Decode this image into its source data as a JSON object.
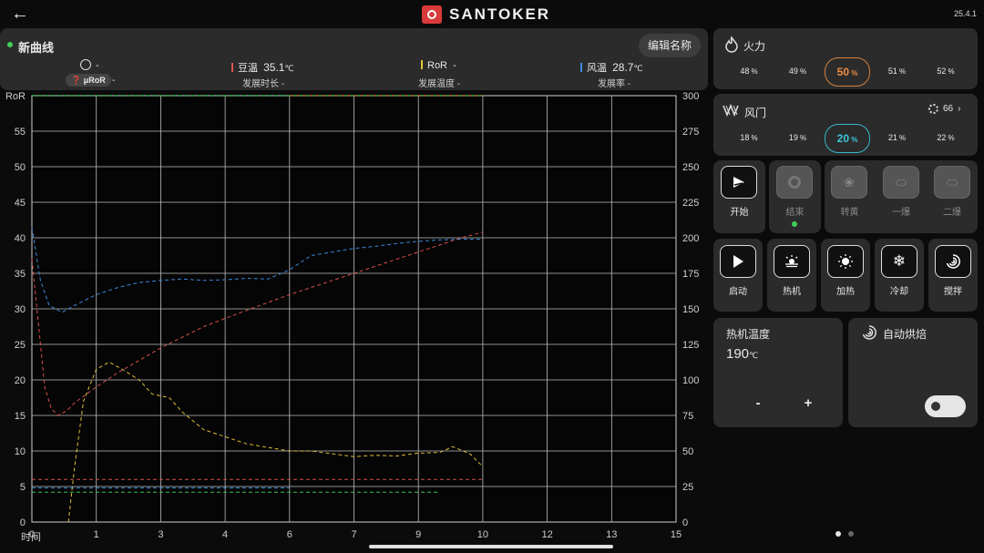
{
  "header": {
    "brand": "SANTOKER",
    "version": "25.4.1"
  },
  "curve": {
    "name": "新曲线",
    "edit_label": "编辑名称",
    "timer_value": "-",
    "mror_label": "μRoR",
    "mror_value": "-",
    "bean_temp_label": "豆温",
    "bean_temp_value": "35.1",
    "ror_label": "RoR",
    "ror_value": "-",
    "air_temp_label": "风温",
    "air_temp_value": "28.7",
    "temp_unit": "℃",
    "dev_time_label": "发展时长",
    "dev_time_value": "-",
    "dev_temp_label": "发展温度",
    "dev_temp_value": "-",
    "dev_rate_label": "发展率",
    "dev_rate_value": "-",
    "colors": {
      "bean": "#e0534f",
      "ror": "#e8c53a",
      "air": "#3e8fe6",
      "dot": "#3fcf5a"
    }
  },
  "fire": {
    "title": "火力",
    "options": [
      "48",
      "49",
      "50",
      "51",
      "52"
    ],
    "selected": "50",
    "unit": "%"
  },
  "damper": {
    "title": "风门",
    "fan_value": "66",
    "options": [
      "18",
      "19",
      "20",
      "21",
      "22"
    ],
    "selected": "20",
    "unit": "%"
  },
  "events": {
    "start": "开始",
    "end": "结束",
    "yellow": "转黄",
    "first_crack": "一爆",
    "second_crack": "二爆"
  },
  "controls": {
    "launch": "启动",
    "preheat": "热机",
    "heat": "加热",
    "cool": "冷却",
    "stir": "搅拌"
  },
  "preheat_temp": {
    "title": "热机温度",
    "value": "190",
    "unit": "℃",
    "minus": "-",
    "plus": "+"
  },
  "auto_roast": {
    "title": "自动烘焙",
    "enabled": false
  },
  "chart_data": {
    "type": "line",
    "xlabel": "时间",
    "ylabel_left": "RoR",
    "xlim": [
      0,
      15
    ],
    "ylim_left": [
      0,
      60
    ],
    "ylim_right": [
      0,
      300
    ],
    "x_ticks": [
      "0",
      "1",
      "3",
      "4",
      "6",
      "7",
      "9",
      "10",
      "12",
      "13",
      "15"
    ],
    "y_left_ticks": [
      "0",
      "5",
      "10",
      "15",
      "20",
      "25",
      "30",
      "35",
      "40",
      "45",
      "50",
      "55"
    ],
    "y_right_ticks": [
      "0",
      "25",
      "50",
      "75",
      "100",
      "125",
      "150",
      "175",
      "200",
      "225",
      "250",
      "275",
      "300"
    ],
    "grid": true,
    "series": [
      {
        "axis": "left",
        "color": "#e0534f",
        "x": [
          0,
          0.15,
          0.3,
          0.45,
          0.6,
          0.8,
          1.0,
          1.5,
          2.0,
          3.0,
          4.0,
          5.0,
          6.0,
          7.0,
          8.0,
          9.0,
          10.0,
          10.5
        ],
        "y": [
          37,
          28,
          19,
          16,
          15,
          15.6,
          16.8,
          19,
          21,
          24.5,
          27.5,
          29.8,
          32,
          34,
          36,
          38,
          40,
          40.8
        ]
      },
      {
        "axis": "left",
        "color": "#3e8fe6",
        "x": [
          0,
          0.2,
          0.4,
          0.7,
          1.0,
          1.5,
          2.0,
          2.5,
          3.0,
          3.5,
          4.0,
          4.5,
          5.0,
          5.5,
          6.0,
          6.5,
          7.0,
          7.5,
          8.0,
          8.5,
          9.0,
          9.5,
          10.0,
          10.5
        ],
        "y": [
          41.5,
          34,
          30.5,
          29.5,
          30.5,
          32,
          33,
          33.7,
          34,
          34.2,
          34,
          34.1,
          34.3,
          34.2,
          35.5,
          37.5,
          38,
          38.5,
          38.8,
          39.2,
          39.5,
          39.7,
          39.8,
          39.8
        ]
      },
      {
        "axis": "left",
        "color": "#e8c53a",
        "x": [
          0.85,
          1.0,
          1.2,
          1.5,
          1.8,
          2.1,
          2.5,
          2.8,
          3.2,
          3.5,
          4.0,
          4.5,
          5.0,
          5.5,
          6.0,
          6.5,
          7.0,
          7.5,
          8.0,
          8.5,
          9.0,
          9.5,
          9.8,
          10.2,
          10.5
        ],
        "y": [
          0,
          8,
          17,
          21.5,
          22.5,
          21.5,
          20,
          18,
          17.5,
          15.5,
          13,
          12,
          11,
          10.5,
          10,
          10,
          9.6,
          9.2,
          9.4,
          9.3,
          9.7,
          9.8,
          10.6,
          9.6,
          7.8
        ]
      },
      {
        "axis": "left",
        "color": "#e0534f",
        "style": "dashed-flat",
        "x": [
          0,
          10.5
        ],
        "y": [
          6,
          6
        ]
      },
      {
        "axis": "left",
        "color": "#3e8fe6",
        "style": "dashed-flat",
        "x": [
          0,
          6.0
        ],
        "y": [
          4.8,
          4.8
        ]
      },
      {
        "axis": "left",
        "color": "#3fcf5a",
        "style": "dashed-flat",
        "x": [
          0,
          9.5
        ],
        "y": [
          4.2,
          4.2
        ]
      }
    ]
  }
}
